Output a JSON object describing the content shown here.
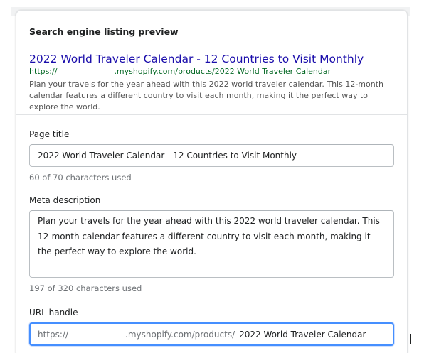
{
  "preview": {
    "heading": "Search engine listing preview",
    "title": "2022 World Traveler Calendar - 12 Countries to Visit Monthly",
    "url_prefix": "https://",
    "url_suffix": ".myshopify.com/products/2022 World Traveler Calendar",
    "description": "Plan your travels for the year ahead with this 2022 world traveler calendar. This 12-month calendar features a different country to visit each month, making it the perfect way to explore the world."
  },
  "page_title": {
    "label": "Page title",
    "value": "2022 World Traveler Calendar - 12 Countries to Visit Monthly",
    "help": "60 of 70 characters used"
  },
  "meta_description": {
    "label": "Meta description",
    "value": "Plan your travels for the year ahead with this 2022 world traveler calendar. This 12-month calendar features a different country to visit each month, making it the perfect way to explore the world.",
    "help": "197 of 320 characters used"
  },
  "url_handle": {
    "label": "URL handle",
    "prefix_start": "https://",
    "prefix_end": ".myshopify.com/products/",
    "value": "2022 World Traveler Calendar"
  },
  "colors": {
    "link_title": "#1a0dab",
    "url_green": "#006621",
    "focus_border": "#458fff"
  }
}
